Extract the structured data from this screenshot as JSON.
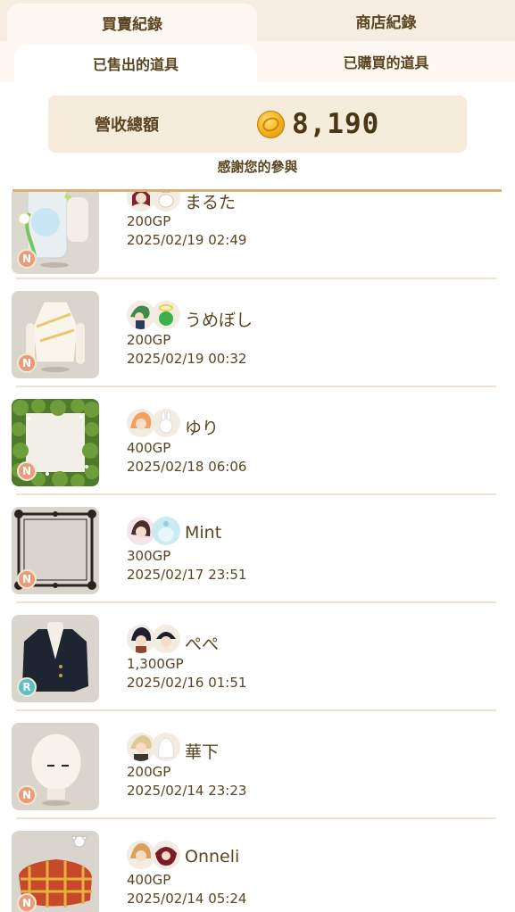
{
  "tabs": {
    "top": [
      {
        "label": "買賣紀錄",
        "active": true
      },
      {
        "label": "商店紀錄",
        "active": false
      }
    ],
    "sub": [
      {
        "label": "已售出的道具",
        "active": true
      },
      {
        "label": "已購買的道具",
        "active": false
      }
    ]
  },
  "revenue": {
    "label": "營收總額",
    "icon": "gold-coin-icon",
    "value": "8,190"
  },
  "thanks": "感謝您的參與",
  "colors": {
    "tab_bar": "#f4ede0",
    "active_tab": "#fdf9f2",
    "revenue_bg": "#f5ecdc",
    "text": "#5b4520",
    "divider": "#d4b27a",
    "rarity_n": "#e79d7b",
    "rarity_r": "#5bc1c6"
  },
  "items": [
    {
      "seller": "まるた",
      "price": "200GP",
      "date": "2025/02/19 02:49",
      "rarity": "N",
      "thumb": "lantern-vase-icon"
    },
    {
      "seller": "うめぼし",
      "price": "200GP",
      "date": "2025/02/19 00:32",
      "rarity": "N",
      "thumb": "white-top-icon"
    },
    {
      "seller": "ゆり",
      "price": "400GP",
      "date": "2025/02/18 06:06",
      "rarity": "N",
      "thumb": "leaf-frame-icon"
    },
    {
      "seller": "Mint",
      "price": "300GP",
      "date": "2025/02/17 23:51",
      "rarity": "N",
      "thumb": "ornate-frame-icon"
    },
    {
      "seller": "ぺぺ",
      "price": "1,300GP",
      "date": "2025/02/16 01:51",
      "rarity": "R",
      "thumb": "black-jacket-icon"
    },
    {
      "seller": "華下",
      "price": "200GP",
      "date": "2025/02/14 23:23",
      "rarity": "N",
      "thumb": "bald-head-icon"
    },
    {
      "seller": "Onneli",
      "price": "400GP",
      "date": "2025/02/14 05:24",
      "rarity": "N",
      "thumb": "plaid-cushion-icon"
    }
  ]
}
